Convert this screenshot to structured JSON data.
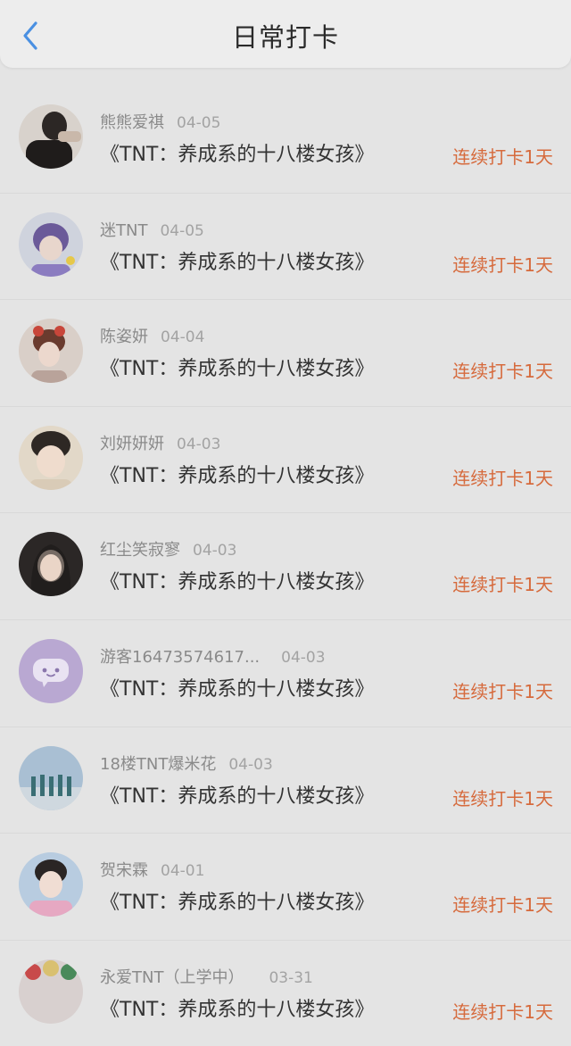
{
  "header": {
    "title": "日常打卡",
    "back_icon": "chevron-left-icon",
    "accent": "#4a90e2"
  },
  "colors": {
    "streak": "#d66a3c",
    "background": "#e4e4e4"
  },
  "entries": [
    {
      "name": "熊熊爱祺",
      "date": "04-05",
      "book": "《TNT：养成系的十八楼女孩》",
      "streak": "连续打卡1天",
      "avatar": "photo"
    },
    {
      "name": "迷TNT",
      "date": "04-05",
      "book": "《TNT：养成系的十八楼女孩》",
      "streak": "连续打卡1天",
      "avatar": "photo"
    },
    {
      "name": "陈姿妍",
      "date": "04-04",
      "book": "《TNT：养成系的十八楼女孩》",
      "streak": "连续打卡1天",
      "avatar": "photo"
    },
    {
      "name": "刘妍妍妍",
      "date": "04-03",
      "book": "《TNT：养成系的十八楼女孩》",
      "streak": "连续打卡1天",
      "avatar": "photo"
    },
    {
      "name": "红尘笑寂寥",
      "date": "04-03",
      "book": "《TNT：养成系的十八楼女孩》",
      "streak": "连续打卡1天",
      "avatar": "photo"
    },
    {
      "name": "游客16473574617...",
      "date": "04-03",
      "book": "《TNT：养成系的十八楼女孩》",
      "streak": "连续打卡1天",
      "avatar": "chat-bubble-icon"
    },
    {
      "name": "18楼TNT爆米花",
      "date": "04-03",
      "book": "《TNT：养成系的十八楼女孩》",
      "streak": "连续打卡1天",
      "avatar": "photo"
    },
    {
      "name": "贺宋霖",
      "date": "04-01",
      "book": "《TNT：养成系的十八楼女孩》",
      "streak": "连续打卡1天",
      "avatar": "photo"
    },
    {
      "name": "永爱TNT（上学中）",
      "date": "03-31",
      "book": "《TNT：养成系的十八楼女孩》",
      "streak": "连续打卡1天",
      "avatar": "photo"
    }
  ]
}
